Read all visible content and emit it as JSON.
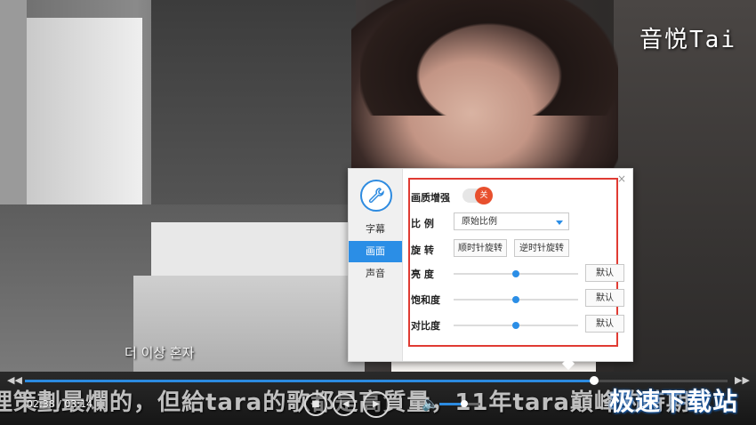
{
  "video": {
    "korean_subtitle": "더 이상 혼자",
    "corner_watermark": "音悦Tai"
  },
  "player": {
    "time_display": "02:38 / 03:14",
    "progress": 0.81,
    "volume": 0.6,
    "bottom_subtitle": "理策劃最爛的，但給tara的歌都是高質量，11年tara巔峰的時期",
    "watermark": "极速下载站",
    "buttons": {
      "stop_icon": "■",
      "prev_icon": "|◀",
      "play_icon": "▶",
      "volume_icon": "🔈",
      "seek_left_icon": "◀◀",
      "seek_right_icon": "▶▶"
    }
  },
  "settings_panel": {
    "close_icon": "×",
    "tabs": [
      {
        "label": "字幕",
        "active": false
      },
      {
        "label": "画面",
        "active": true
      },
      {
        "label": "声音",
        "active": false
      }
    ],
    "enhance": {
      "label": "画质增强",
      "state": "关"
    },
    "ratio": {
      "label": "比  例",
      "value": "原始比例"
    },
    "rotate": {
      "label": "旋  转",
      "clockwise": "顺时针旋转",
      "counter": "逆时针旋转"
    },
    "brightness": {
      "label": "亮  度",
      "value": 0.5,
      "reset": "默认"
    },
    "saturation": {
      "label": "饱和度",
      "value": 0.5,
      "reset": "默认"
    },
    "contrast": {
      "label": "对比度",
      "value": 0.5,
      "reset": "默认"
    },
    "accent_color": "#2b8ee6",
    "highlight_color": "#e03b33"
  }
}
